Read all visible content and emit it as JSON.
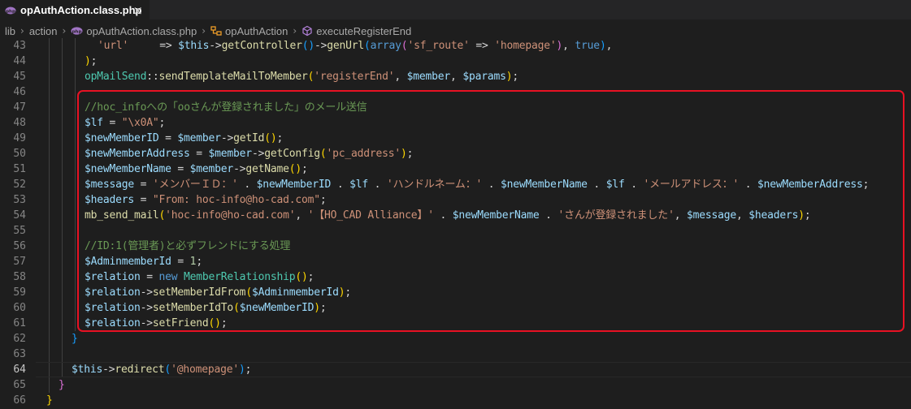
{
  "tab": {
    "icon": "php-elephant-icon",
    "title": "opAuthAction.class.php",
    "close": "×"
  },
  "breadcrumb": {
    "items": [
      "lib",
      "action",
      "opAuthAction.class.php",
      "opAuthAction",
      "executeRegisterEnd"
    ],
    "separator": "›"
  },
  "editor": {
    "line_numbers": [
      "43",
      "44",
      "45",
      "46",
      "47",
      "48",
      "49",
      "50",
      "51",
      "52",
      "53",
      "54",
      "55",
      "56",
      "57",
      "58",
      "59",
      "60",
      "61",
      "62",
      "63",
      "64",
      "65",
      "66"
    ],
    "active_line": "64",
    "lines": [
      {
        "n": "43",
        "tokens": [
          [
            "str",
            "'url'"
          ],
          [
            "op",
            "     => "
          ],
          [
            "var",
            "$this"
          ],
          [
            "op",
            "->"
          ],
          [
            "fn",
            "getController"
          ],
          [
            "br3",
            "()"
          ],
          [
            "op",
            "->"
          ],
          [
            "fn",
            "genUrl"
          ],
          [
            "br3",
            "("
          ],
          [
            "kw",
            "array"
          ],
          [
            "br2",
            "("
          ],
          [
            "str",
            "'sf_route'"
          ],
          [
            "op",
            " => "
          ],
          [
            "str",
            "'homepage'"
          ],
          [
            "br2",
            ")"
          ],
          [
            "op",
            ", "
          ],
          [
            "kw",
            "true"
          ],
          [
            "br3",
            ")"
          ],
          [
            "op",
            ","
          ]
        ]
      },
      {
        "n": "44",
        "tokens": [
          [
            "br1",
            ")"
          ],
          [
            "op",
            ";"
          ]
        ]
      },
      {
        "n": "45",
        "tokens": [
          [
            "cls",
            "opMailSend"
          ],
          [
            "op",
            "::"
          ],
          [
            "fn",
            "sendTemplateMailToMember"
          ],
          [
            "br1",
            "("
          ],
          [
            "str",
            "'registerEnd'"
          ],
          [
            "op",
            ", "
          ],
          [
            "var",
            "$member"
          ],
          [
            "op",
            ", "
          ],
          [
            "var",
            "$params"
          ],
          [
            "br1",
            ")"
          ],
          [
            "op",
            ";"
          ]
        ]
      },
      {
        "n": "46",
        "tokens": []
      },
      {
        "n": "47",
        "tokens": [
          [
            "cm",
            "//hoc_infoへの「ooさんが登録されました」のメール送信"
          ]
        ]
      },
      {
        "n": "48",
        "tokens": [
          [
            "var",
            "$lf"
          ],
          [
            "op",
            " = "
          ],
          [
            "str",
            "\"\\x0A\""
          ],
          [
            "op",
            ";"
          ]
        ]
      },
      {
        "n": "49",
        "tokens": [
          [
            "var",
            "$newMemberID"
          ],
          [
            "op",
            " = "
          ],
          [
            "var",
            "$member"
          ],
          [
            "op",
            "->"
          ],
          [
            "fn",
            "getId"
          ],
          [
            "br1",
            "()"
          ],
          [
            "op",
            ";"
          ]
        ]
      },
      {
        "n": "50",
        "tokens": [
          [
            "var",
            "$newMemberAddress"
          ],
          [
            "op",
            " = "
          ],
          [
            "var",
            "$member"
          ],
          [
            "op",
            "->"
          ],
          [
            "fn",
            "getConfig"
          ],
          [
            "br1",
            "("
          ],
          [
            "str",
            "'pc_address'"
          ],
          [
            "br1",
            ")"
          ],
          [
            "op",
            ";"
          ]
        ]
      },
      {
        "n": "51",
        "tokens": [
          [
            "var",
            "$newMemberName"
          ],
          [
            "op",
            " = "
          ],
          [
            "var",
            "$member"
          ],
          [
            "op",
            "->"
          ],
          [
            "fn",
            "getName"
          ],
          [
            "br1",
            "()"
          ],
          [
            "op",
            ";"
          ]
        ]
      },
      {
        "n": "52",
        "tokens": [
          [
            "var",
            "$message"
          ],
          [
            "op",
            " = "
          ],
          [
            "str",
            "'メンバーＩＤ：'"
          ],
          [
            "op",
            " . "
          ],
          [
            "var",
            "$newMemberID"
          ],
          [
            "op",
            " . "
          ],
          [
            "var",
            "$lf"
          ],
          [
            "op",
            " . "
          ],
          [
            "str",
            "'ハンドルネーム：'"
          ],
          [
            "op",
            " . "
          ],
          [
            "var",
            "$newMemberName"
          ],
          [
            "op",
            " . "
          ],
          [
            "var",
            "$lf"
          ],
          [
            "op",
            " . "
          ],
          [
            "str",
            "'メールアドレス：'"
          ],
          [
            "op",
            " . "
          ],
          [
            "var",
            "$newMemberAddress"
          ],
          [
            "op",
            ";"
          ]
        ]
      },
      {
        "n": "53",
        "tokens": [
          [
            "var",
            "$headers"
          ],
          [
            "op",
            " = "
          ],
          [
            "str",
            "\"From: hoc-info@ho-cad.com\""
          ],
          [
            "op",
            ";"
          ]
        ]
      },
      {
        "n": "54",
        "tokens": [
          [
            "fn",
            "mb_send_mail"
          ],
          [
            "br1",
            "("
          ],
          [
            "str",
            "'hoc-info@ho-cad.com'"
          ],
          [
            "op",
            ", "
          ],
          [
            "str",
            "'【HO_CAD Alliance】'"
          ],
          [
            "op",
            " . "
          ],
          [
            "var",
            "$newMemberName"
          ],
          [
            "op",
            " . "
          ],
          [
            "str",
            "'さんが登録されました'"
          ],
          [
            "op",
            ", "
          ],
          [
            "var",
            "$message"
          ],
          [
            "op",
            ", "
          ],
          [
            "var",
            "$headers"
          ],
          [
            "br1",
            ")"
          ],
          [
            "op",
            ";"
          ]
        ]
      },
      {
        "n": "55",
        "tokens": []
      },
      {
        "n": "56",
        "tokens": [
          [
            "cm",
            "//ID:1(管理者)と必ずフレンドにする処理"
          ]
        ]
      },
      {
        "n": "57",
        "tokens": [
          [
            "var",
            "$AdminmemberId"
          ],
          [
            "op",
            " = "
          ],
          [
            "num",
            "1"
          ],
          [
            "op",
            ";"
          ]
        ]
      },
      {
        "n": "58",
        "tokens": [
          [
            "var",
            "$relation"
          ],
          [
            "op",
            " = "
          ],
          [
            "kw",
            "new "
          ],
          [
            "cls",
            "MemberRelationship"
          ],
          [
            "br1",
            "()"
          ],
          [
            "op",
            ";"
          ]
        ]
      },
      {
        "n": "59",
        "tokens": [
          [
            "var",
            "$relation"
          ],
          [
            "op",
            "->"
          ],
          [
            "fn",
            "setMemberIdFrom"
          ],
          [
            "br1",
            "("
          ],
          [
            "var",
            "$AdminmemberId"
          ],
          [
            "br1",
            ")"
          ],
          [
            "op",
            ";"
          ]
        ]
      },
      {
        "n": "60",
        "tokens": [
          [
            "var",
            "$relation"
          ],
          [
            "op",
            "->"
          ],
          [
            "fn",
            "setMemberIdTo"
          ],
          [
            "br1",
            "("
          ],
          [
            "var",
            "$newMemberID"
          ],
          [
            "br1",
            ")"
          ],
          [
            "op",
            ";"
          ]
        ]
      },
      {
        "n": "61",
        "tokens": [
          [
            "var",
            "$relation"
          ],
          [
            "op",
            "->"
          ],
          [
            "fn",
            "setFriend"
          ],
          [
            "br1",
            "()"
          ],
          [
            "op",
            ";"
          ]
        ]
      },
      {
        "n": "62",
        "tokens": [
          [
            "br3",
            "}"
          ]
        ]
      },
      {
        "n": "63",
        "tokens": []
      },
      {
        "n": "64",
        "tokens": [
          [
            "var",
            "$this"
          ],
          [
            "op",
            "->"
          ],
          [
            "fn",
            "redirect"
          ],
          [
            "br3",
            "("
          ],
          [
            "str",
            "'@homepage'"
          ],
          [
            "br3",
            ")"
          ],
          [
            "op",
            ";"
          ]
        ]
      },
      {
        "n": "65",
        "tokens": [
          [
            "br2",
            "}"
          ]
        ]
      },
      {
        "n": "66",
        "tokens": [
          [
            "br1",
            "}"
          ]
        ]
      }
    ]
  },
  "colors": {
    "background": "#1e1e1e",
    "highlight_border": "#e81123",
    "keyword": "#569cd6",
    "variable": "#9cdcfe",
    "function": "#dcdcaa",
    "string": "#ce9178",
    "comment": "#6a9955",
    "number": "#b5cea8",
    "class": "#4ec9b0"
  }
}
